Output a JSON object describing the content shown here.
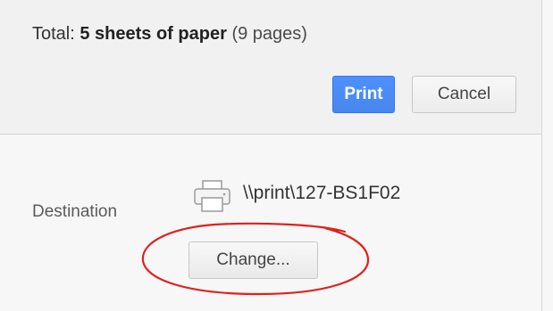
{
  "summary": {
    "prefix": "Total: ",
    "sheets": "5 sheets of paper",
    "pages": "(9 pages)"
  },
  "buttons": {
    "print_label": "Print",
    "cancel_label": "Cancel",
    "change_label": "Change..."
  },
  "destination": {
    "label": "Destination",
    "printer_name": "\\\\print\\127-BS1F02",
    "icon": "printer-icon"
  },
  "colors": {
    "print_button": "#4d90fe",
    "highlight_ellipse": "#e0201b"
  }
}
